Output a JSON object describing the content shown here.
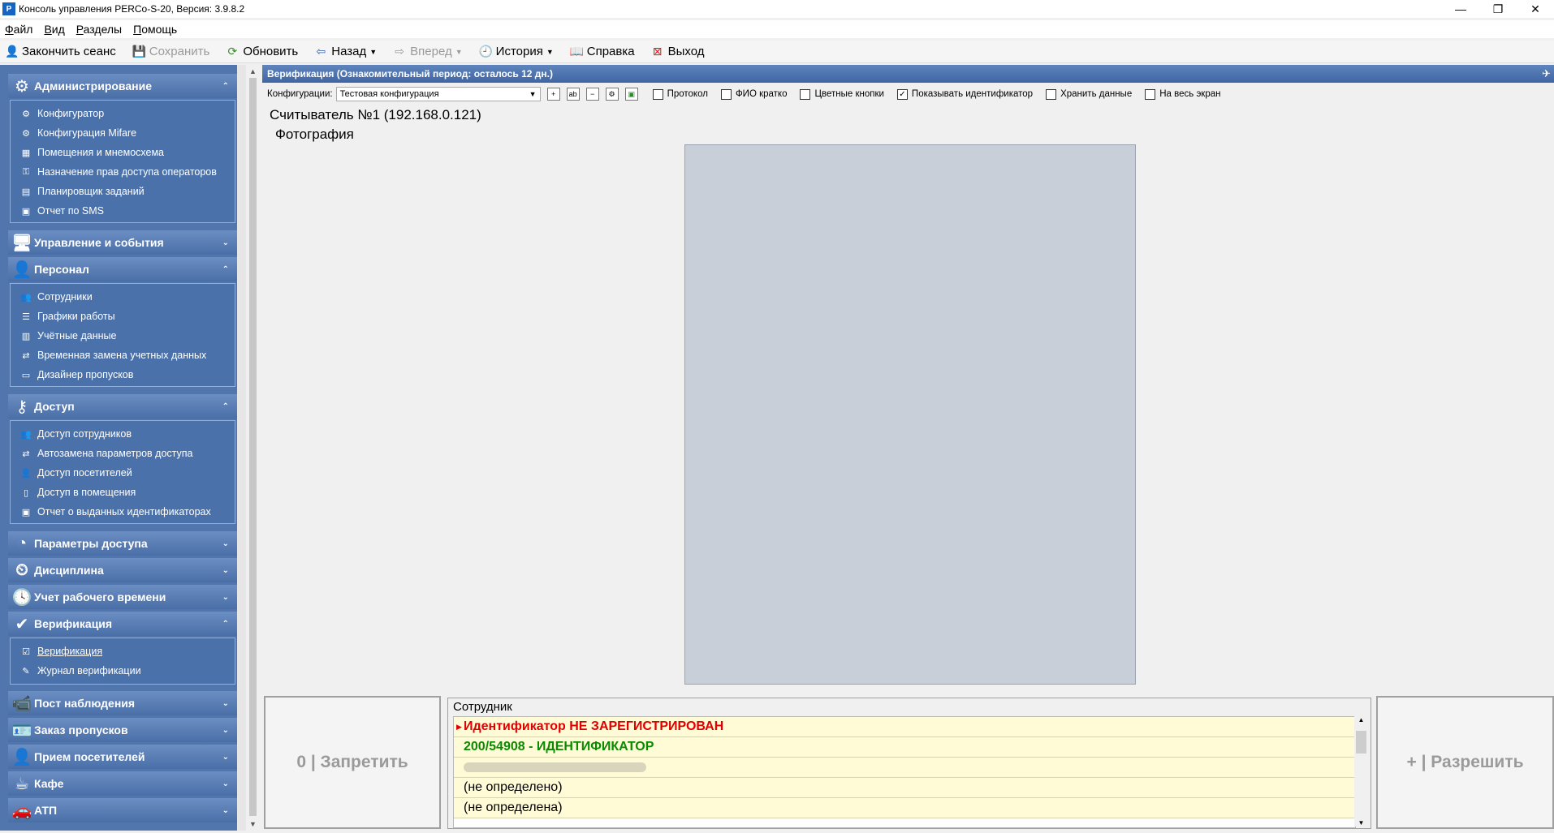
{
  "window": {
    "title": "Консоль управления PERCo-S-20, Версия: 3.9.8.2",
    "minimize": "—",
    "restore": "❐",
    "close": "✕"
  },
  "menu": [
    "Файл",
    "Вид",
    "Разделы",
    "Помощь"
  ],
  "toolbar": {
    "end_session": "Закончить сеанс",
    "save": "Сохранить",
    "refresh": "Обновить",
    "back": "Назад",
    "forward": "Вперед",
    "history": "История",
    "help": "Справка",
    "exit": "Выход"
  },
  "sidebar": {
    "admin": {
      "title": "Администрирование",
      "items": [
        "Конфигуратор",
        "Конфигурация Mifare",
        "Помещения и мнемосхема",
        "Назначение прав доступа операторов",
        "Планировщик заданий",
        "Отчет по SMS"
      ]
    },
    "control": {
      "title": "Управление и события"
    },
    "personnel": {
      "title": "Персонал",
      "items": [
        "Сотрудники",
        "Графики работы",
        "Учётные данные",
        "Временная замена учетных данных",
        "Дизайнер пропусков"
      ]
    },
    "access": {
      "title": "Доступ",
      "items": [
        "Доступ сотрудников",
        "Автозамена параметров доступа",
        "Доступ посетителей",
        "Доступ в помещения",
        "Отчет о выданных идентификаторах"
      ]
    },
    "access_params": {
      "title": "Параметры доступа"
    },
    "discipline": {
      "title": "Дисциплина"
    },
    "worktime": {
      "title": "Учет рабочего времени"
    },
    "verification": {
      "title": "Верификация",
      "items": [
        "Верификация",
        "Журнал верификации"
      ]
    },
    "watch": {
      "title": "Пост наблюдения"
    },
    "passes": {
      "title": "Заказ пропусков"
    },
    "visitors": {
      "title": "Прием посетителей"
    },
    "cafe": {
      "title": "Кафе"
    },
    "atp": {
      "title": "АТП"
    }
  },
  "main": {
    "header": "Верификация (Ознакомительный период: осталось 12 дн.)",
    "config_label": "Конфигурации:",
    "config_value": "Тестовая конфигурация",
    "checkboxes": [
      {
        "label": "Протокол",
        "checked": false
      },
      {
        "label": "ФИО кратко",
        "checked": false
      },
      {
        "label": "Цветные кнопки",
        "checked": false
      },
      {
        "label": "Показывать идентификатор",
        "checked": true
      },
      {
        "label": "Хранить данные",
        "checked": false
      },
      {
        "label": "На весь экран",
        "checked": false
      }
    ],
    "reader_label": "Считыватель №1 (192.168.0.121)",
    "photo_label": "Фотография"
  },
  "bottom": {
    "deny_label": "0 | Запретить",
    "allow_label": "+ | Разрешить",
    "employee_title": "Сотрудник",
    "rows": [
      "Идентификатор НЕ ЗАРЕГИСТРИРОВАН",
      "200/54908 - ИДЕНТИФИКАТОР",
      "",
      "(не определено)",
      "(не определена)"
    ]
  }
}
